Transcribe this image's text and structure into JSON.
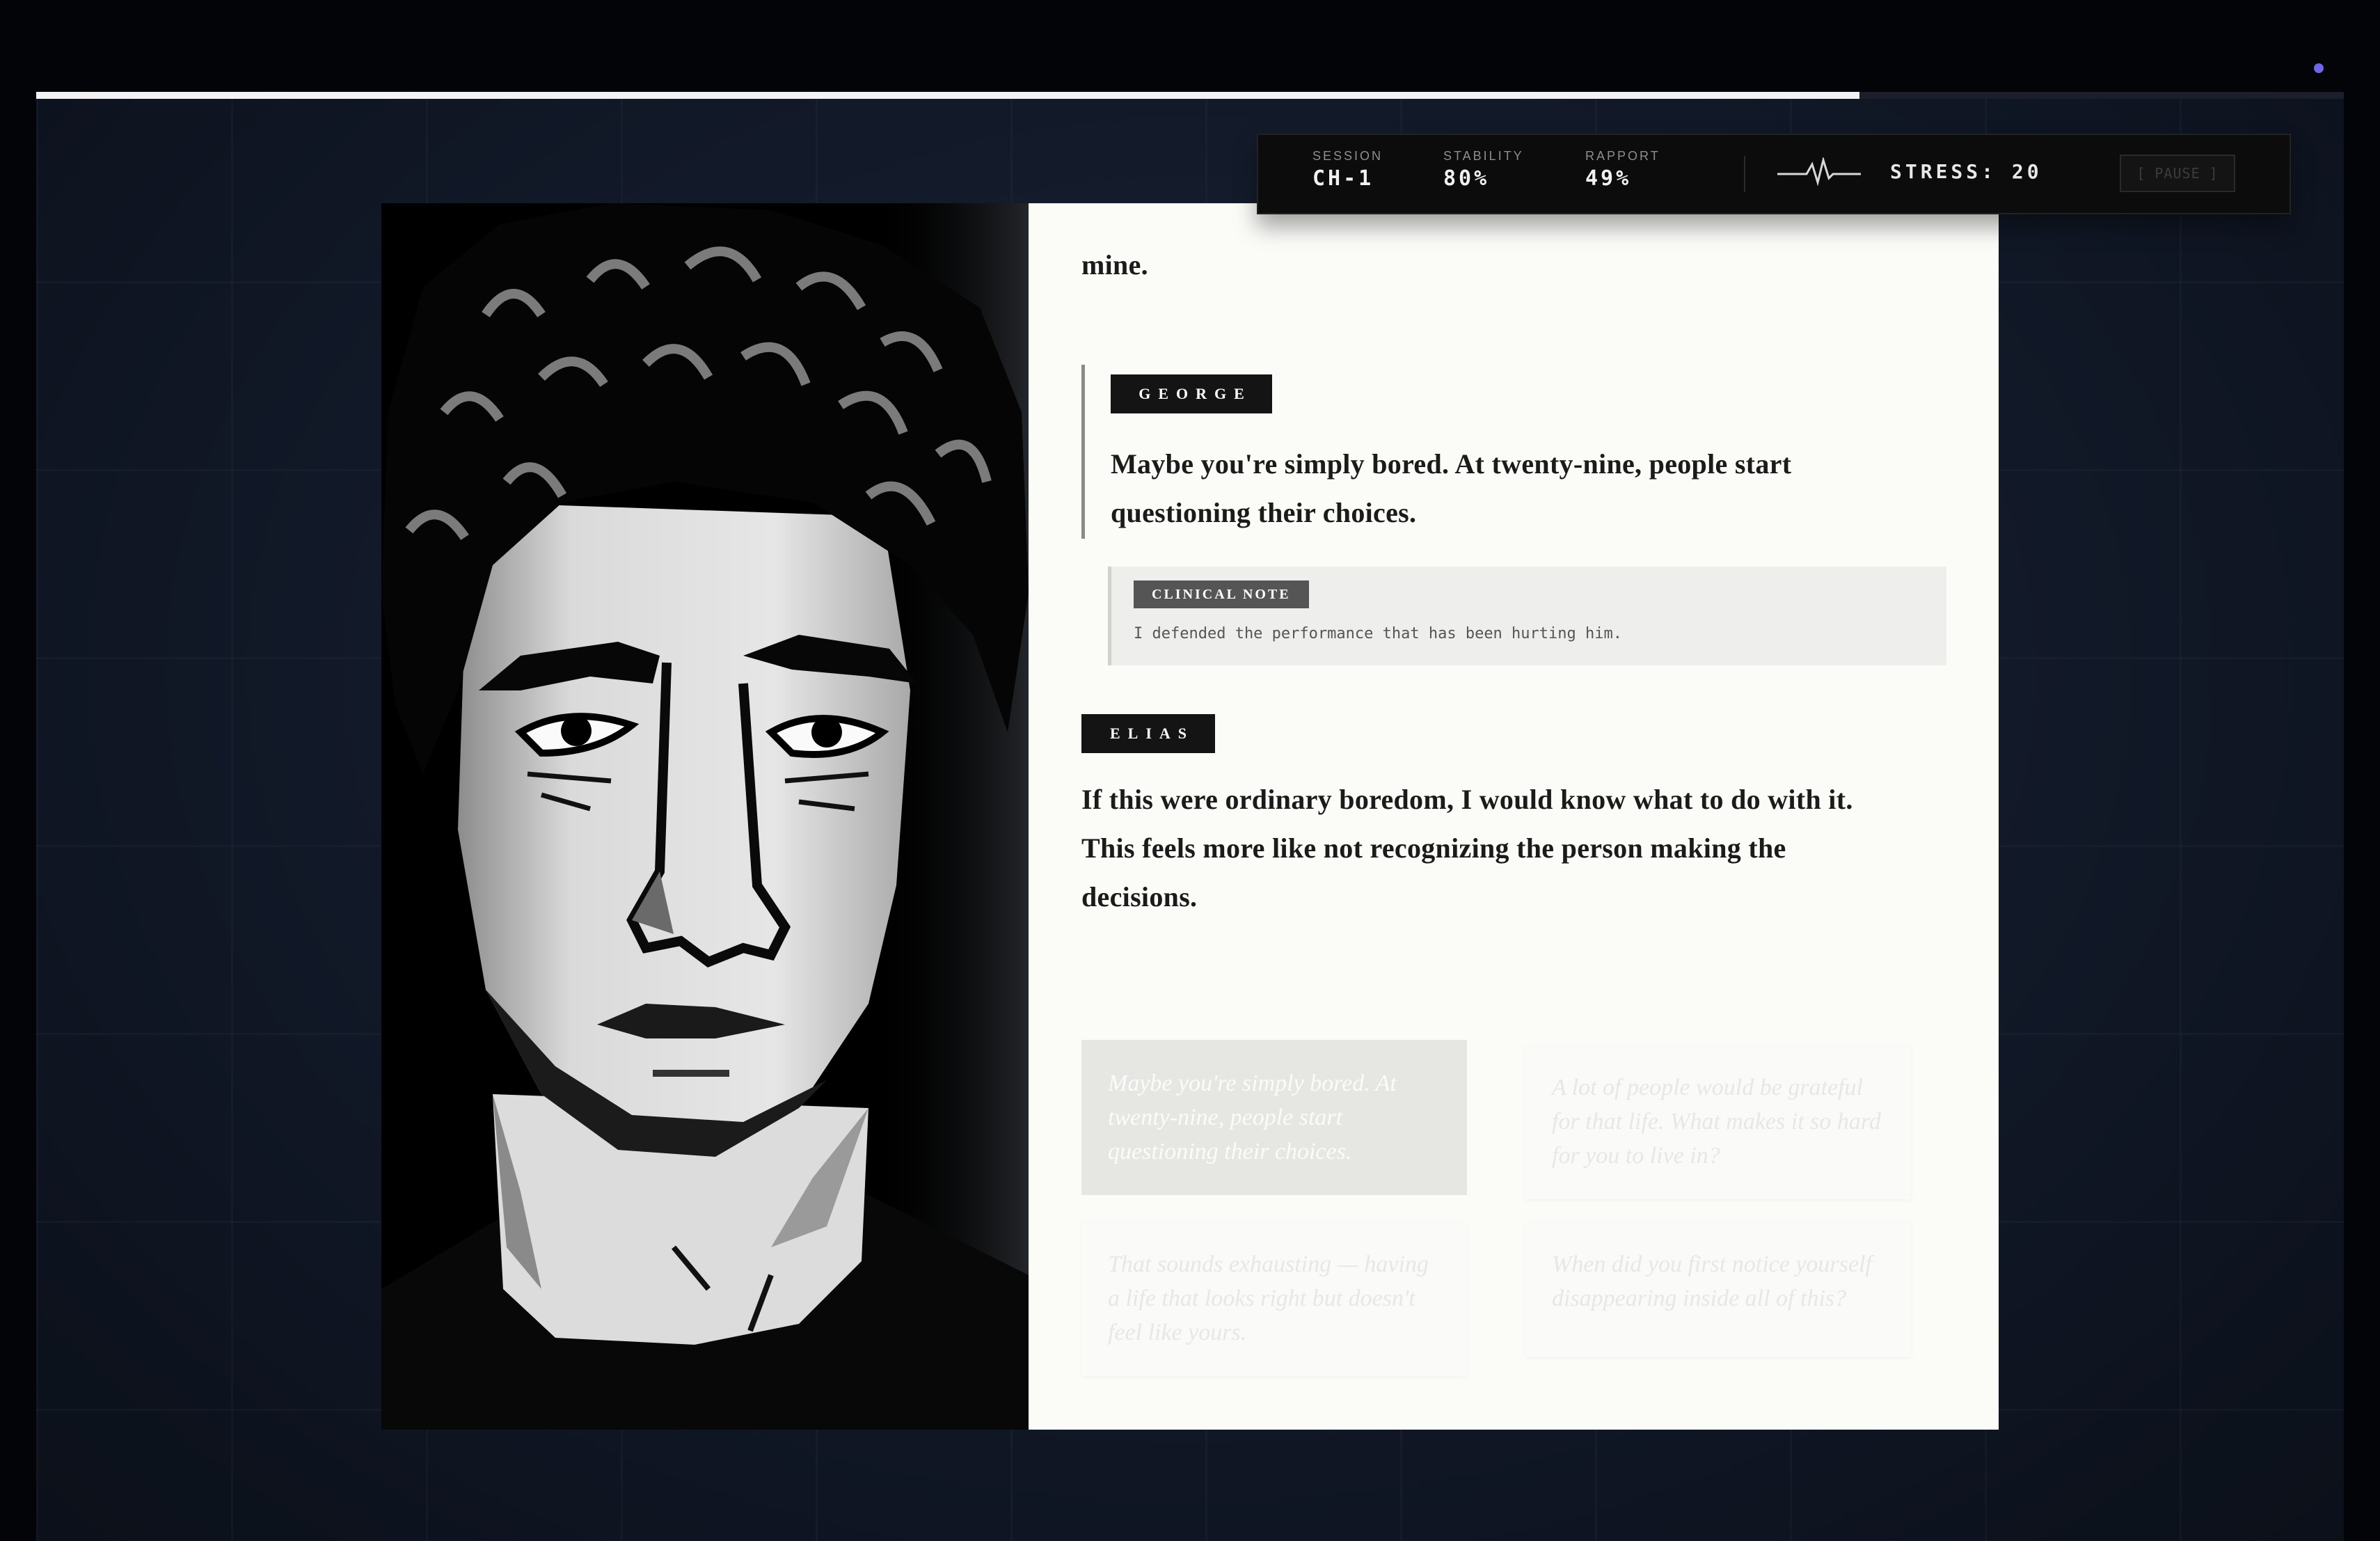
{
  "session": {
    "label": "SESSION",
    "value": "CH-1"
  },
  "stability": {
    "label": "STABILITY",
    "value": "80%"
  },
  "rapport": {
    "label": "RAPPORT",
    "value": "49%"
  },
  "stress": {
    "text": "STRESS: 20"
  },
  "pause_button": {
    "label": "[ PAUSE ]"
  },
  "progress": {
    "fraction": 0.79
  },
  "dialogue": {
    "prior_tail": "mine.",
    "george": {
      "speaker": "GEORGE",
      "line": "Maybe you're simply bored. At twenty-nine, people start questioning their choices."
    },
    "clinical_note": {
      "label": "CLINICAL NOTE",
      "text": "I defended the performance that has been hurting him."
    },
    "elias": {
      "speaker": "ELIAS",
      "line": "If this were ordinary boredom, I would know what to do with it. This feels more like not recognizing the person making the decisions."
    }
  },
  "choices": [
    {
      "text": "Maybe you're simply bored. At twenty-nine, people start questioning their choices.",
      "state": "selected"
    },
    {
      "text": "A lot of people would be grateful for that life. What makes it so hard for you to live in?",
      "state": "disabled"
    },
    {
      "text": "That sounds exhausting — having a life that looks right but doesn't feel like yours.",
      "state": "disabled"
    },
    {
      "text": "When did you first notice yourself disappearing inside all of this?",
      "state": "disabled"
    }
  ],
  "colors": {
    "accent_dot": "#6e66e6",
    "panel": "#fbfbf8",
    "background": "#111827"
  },
  "portrait": {
    "subject": "elias-pixel-portrait"
  }
}
